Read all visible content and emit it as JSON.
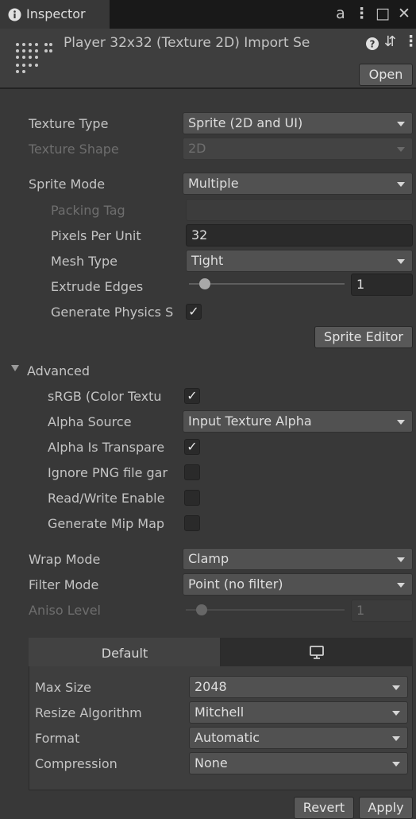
{
  "window": {
    "tab_label": "Inspector",
    "tab_icon": "info-icon",
    "toolbar": {
      "lock": "a",
      "menu": "⋮",
      "maximize": "□",
      "close": "✕"
    }
  },
  "header": {
    "title": "Player 32x32 (Texture 2D) Import Se",
    "open_label": "Open",
    "help_icon": "?",
    "preset_icon": "⇵",
    "more_icon": "⋮"
  },
  "texture_type": {
    "label": "Texture Type",
    "value": "Sprite (2D and UI)"
  },
  "texture_shape": {
    "label": "Texture Shape",
    "value": "2D"
  },
  "sprite_mode": {
    "label": "Sprite Mode",
    "value": "Multiple"
  },
  "packing_tag": {
    "label": "Packing Tag",
    "value": ""
  },
  "pixels_per_unit": {
    "label": "Pixels Per Unit",
    "value": "32"
  },
  "mesh_type": {
    "label": "Mesh Type",
    "value": "Tight"
  },
  "extrude_edges": {
    "label": "Extrude Edges",
    "value": "1",
    "level": 0.1
  },
  "generate_physics": {
    "label": "Generate Physics S",
    "check": "✓"
  },
  "sprite_editor_label": "Sprite Editor",
  "advanced": {
    "label": "Advanced",
    "srgb": {
      "label": "sRGB (Color Textu",
      "check": "✓"
    },
    "alpha_source": {
      "label": "Alpha Source",
      "value": "Input Texture Alpha"
    },
    "alpha_is_transparency": {
      "label": "Alpha Is Transpare",
      "check": "✓"
    },
    "ignore_png": {
      "label": "Ignore PNG file gar",
      "check": ""
    },
    "read_write": {
      "label": "Read/Write Enable",
      "check": ""
    },
    "mip_maps": {
      "label": "Generate Mip Map",
      "check": ""
    }
  },
  "wrap_mode": {
    "label": "Wrap Mode",
    "value": "Clamp"
  },
  "filter_mode": {
    "label": "Filter Mode",
    "value": "Point (no filter)"
  },
  "aniso_level": {
    "label": "Aniso Level",
    "value": "1",
    "level": 0.1
  },
  "platform": {
    "default_tab": "Default",
    "other_tab_icon": "monitor-icon",
    "max_size": {
      "label": "Max Size",
      "value": "2048"
    },
    "resize_algorithm": {
      "label": "Resize Algorithm",
      "value": "Mitchell"
    },
    "format": {
      "label": "Format",
      "value": "Automatic"
    },
    "compression": {
      "label": "Compression",
      "value": "None"
    }
  },
  "footer": {
    "revert_label": "Revert",
    "apply_label": "Apply"
  },
  "colors": {
    "background": "#383838",
    "tabbar": "#191919",
    "field": "#2a2a2a",
    "dropdown": "#515151"
  }
}
